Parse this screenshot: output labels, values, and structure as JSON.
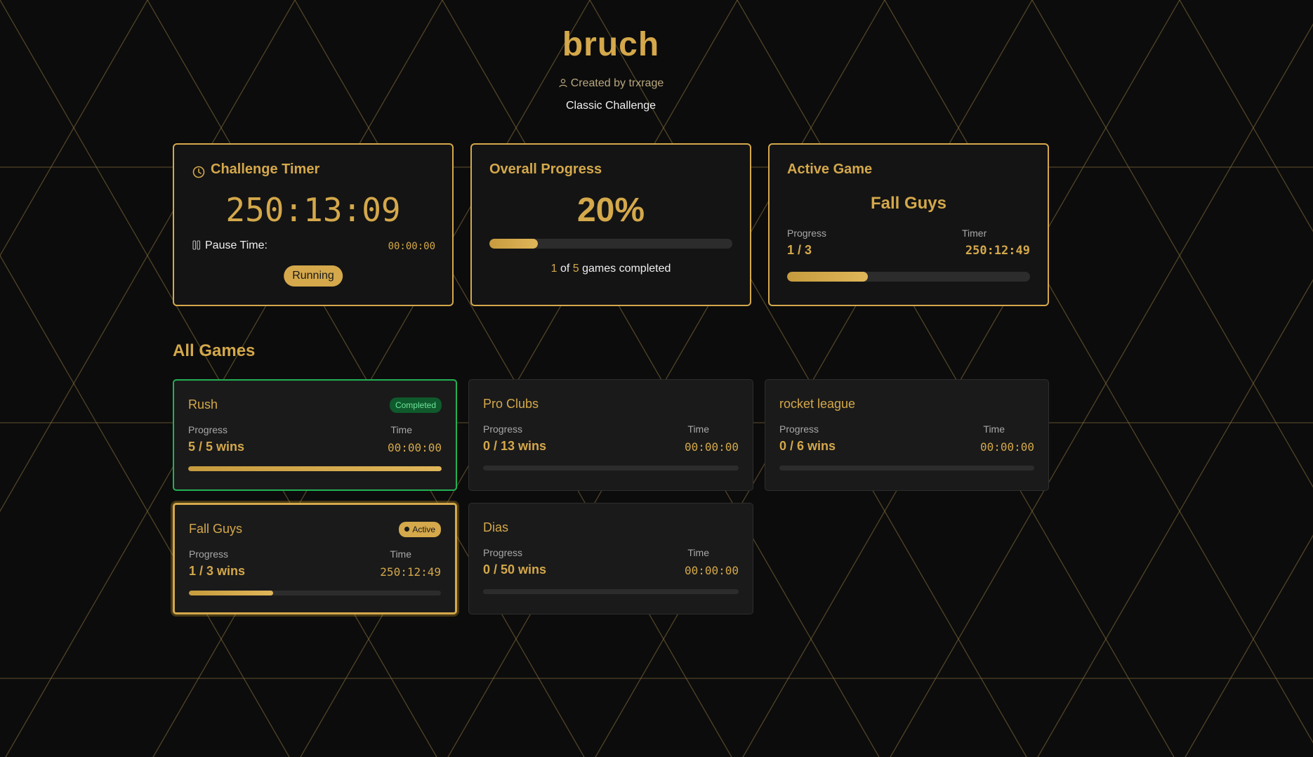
{
  "header": {
    "title": "bruch",
    "creator": "Created by trxrage",
    "creator_icon": "user-icon",
    "subtitle": "Classic Challenge"
  },
  "challenge_timer": {
    "title": "Challenge Timer",
    "icon": "clock-icon",
    "time": "250:13:09",
    "pause_label": "Pause Time:",
    "pause_icon": "pause-icon",
    "pause_value": "00:00:00",
    "status": "Running"
  },
  "overall_progress": {
    "title": "Overall Progress",
    "percent_label": "20%",
    "percent": 20,
    "completed": "1",
    "of_text": "of",
    "total": "5",
    "suffix": "games completed"
  },
  "active_game": {
    "title": "Active Game",
    "name": "Fall Guys",
    "progress_label": "Progress",
    "progress_value": "1 / 3",
    "timer_label": "Timer",
    "timer_value": "250:12:49",
    "fraction": 0.3333
  },
  "all_games": {
    "title": "All Games",
    "progress_label": "Progress",
    "time_label": "Time",
    "items": [
      {
        "name": "Rush",
        "progress": "5 / 5 wins",
        "time": "00:00:00",
        "fraction": 1.0,
        "status": "Completed"
      },
      {
        "name": "Pro Clubs",
        "progress": "0 / 13 wins",
        "time": "00:00:00",
        "fraction": 0,
        "status": ""
      },
      {
        "name": "rocket league",
        "progress": "0 / 6 wins",
        "time": "00:00:00",
        "fraction": 0,
        "status": ""
      },
      {
        "name": "Fall Guys",
        "progress": "1 / 3 wins",
        "time": "250:12:49",
        "fraction": 0.3333,
        "status": "Active"
      },
      {
        "name": "Dias",
        "progress": "0 / 50 wins",
        "time": "00:00:00",
        "fraction": 0,
        "status": ""
      }
    ]
  },
  "colors": {
    "accent": "#d4a84b",
    "background": "#0c0c0c",
    "card": "#141414",
    "completed": "#22b055"
  }
}
